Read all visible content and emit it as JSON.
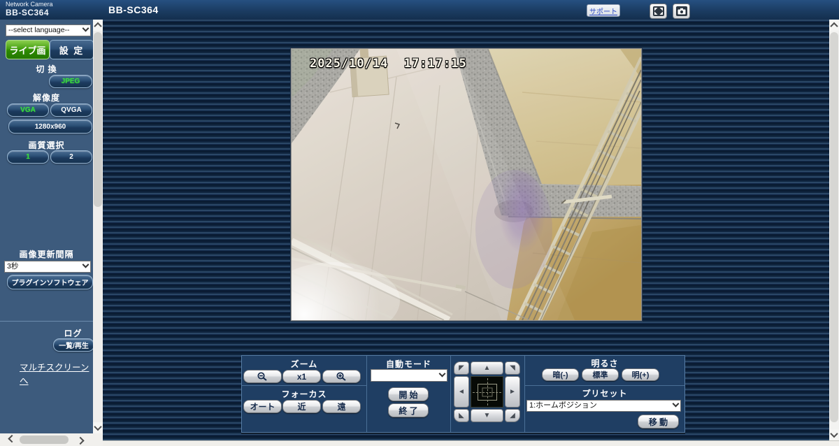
{
  "header": {
    "brand_line1": "Network Camera",
    "brand_line2": "BB-SC364",
    "page_title": "BB-SC364",
    "support_label": "サポート"
  },
  "sidebar": {
    "language_placeholder": "--select language--",
    "tabs": {
      "live": "ライブ画",
      "setup": "設 定"
    },
    "switch": {
      "label": "切 換",
      "jpeg": "JPEG"
    },
    "resolution": {
      "label": "解像度",
      "vga": "VGA",
      "qvga": "QVGA",
      "xga": "1280x960"
    },
    "quality": {
      "label": "画質選択",
      "q1": "1",
      "q2": "2"
    },
    "refresh": {
      "label": "画像更新間隔",
      "value": "3秒"
    },
    "plugin": "プラグインソフトウェア",
    "log": {
      "label": "ログ",
      "list_play": "一覧/再生"
    },
    "multiscreen": "マルチスクリーンへ"
  },
  "live_view": {
    "timestamp": "2025/10/14  17:17:15"
  },
  "controls": {
    "zoom": {
      "label": "ズーム",
      "x1": "x1"
    },
    "focus": {
      "label": "フォーカス",
      "auto": "オート",
      "near": "近",
      "far": "遠"
    },
    "auto_mode": {
      "label": "自動モード",
      "selected": "",
      "start": "開 始",
      "stop": "終 了"
    },
    "brightness": {
      "label": "明るさ",
      "darker": "暗(-)",
      "normal": "標準",
      "brighter": "明(+)"
    },
    "preset": {
      "label": "プリセット",
      "selected": "1:ホームポジション",
      "go": "移 動"
    }
  },
  "colors": {
    "accent_green": "#3ae23a",
    "header_navy": "#1b3c62",
    "sidebar_blue": "#3d5b7d",
    "panel_navy": "#1f3e63",
    "stripe_dark": "#0a1c33",
    "stripe_light": "#2a4766"
  }
}
